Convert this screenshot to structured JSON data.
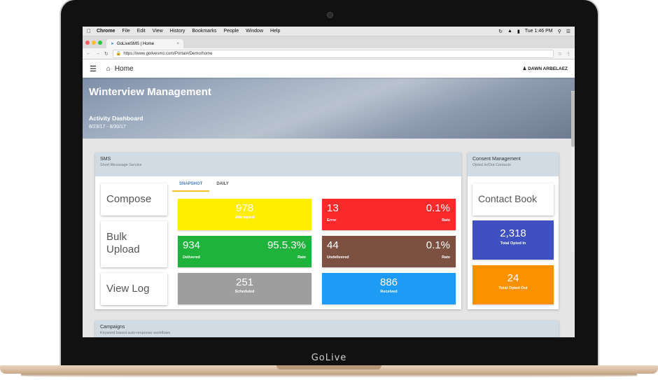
{
  "device": {
    "brand": "GoLive"
  },
  "macos": {
    "app": "Chrome",
    "menu": [
      "File",
      "Edit",
      "View",
      "History",
      "Bookmarks",
      "People",
      "Window",
      "Help"
    ],
    "time": "Tue 1:46 PM"
  },
  "browser": {
    "tab_title": "GoLiveSMS | Home",
    "url": "https://www.golivesms.com/Portal#/Demo/home"
  },
  "appbar": {
    "page_title": "Home",
    "user": "DAWN ARBELAEZ"
  },
  "hero": {
    "title": "Winterview Management",
    "subtitle": "Activity Dashboard",
    "date_range": "8/23/17 - 8/30/17"
  },
  "sms": {
    "title": "SMS",
    "subtitle": "Short Messsage Service",
    "actions": {
      "compose": "Compose",
      "bulk_upload": "Bulk Upload",
      "view_log": "View Log"
    },
    "tabs": {
      "snapshot": "SNAPSHOT",
      "daily": "DAILY"
    },
    "tiles": {
      "attempted": {
        "value": "978",
        "label": "Attempted",
        "color": "#ffee00"
      },
      "error": {
        "value": "13",
        "label": "Error",
        "rate": "0.1%",
        "rate_label": "Rate",
        "color": "#fb2a2a"
      },
      "delivered": {
        "value": "934",
        "label": "Delivered",
        "rate": "95.5.3%",
        "rate_label": "Rate",
        "color": "#1fb33c"
      },
      "undelivered": {
        "value": "44",
        "label": "Undelivered",
        "rate": "0.1%",
        "rate_label": "Rate",
        "color": "#7d5141"
      },
      "scheduled": {
        "value": "251",
        "label": "Scheduled",
        "color": "#9e9e9e"
      },
      "received": {
        "value": "886",
        "label": "Received",
        "color": "#1e9bf5"
      }
    }
  },
  "consent": {
    "title": "Consent Management",
    "subtitle": "Opted In/Out Contacts",
    "contact_book": "Contact Book",
    "opted_in": {
      "value": "2,318",
      "label": "Total Opted In",
      "color": "#3f51c0"
    },
    "opted_out": {
      "value": "24",
      "label": "Total Opted Out",
      "color": "#fb9000"
    }
  },
  "campaigns": {
    "title": "Campaigns",
    "subtitle": "Keyword based auto-response workflows"
  }
}
